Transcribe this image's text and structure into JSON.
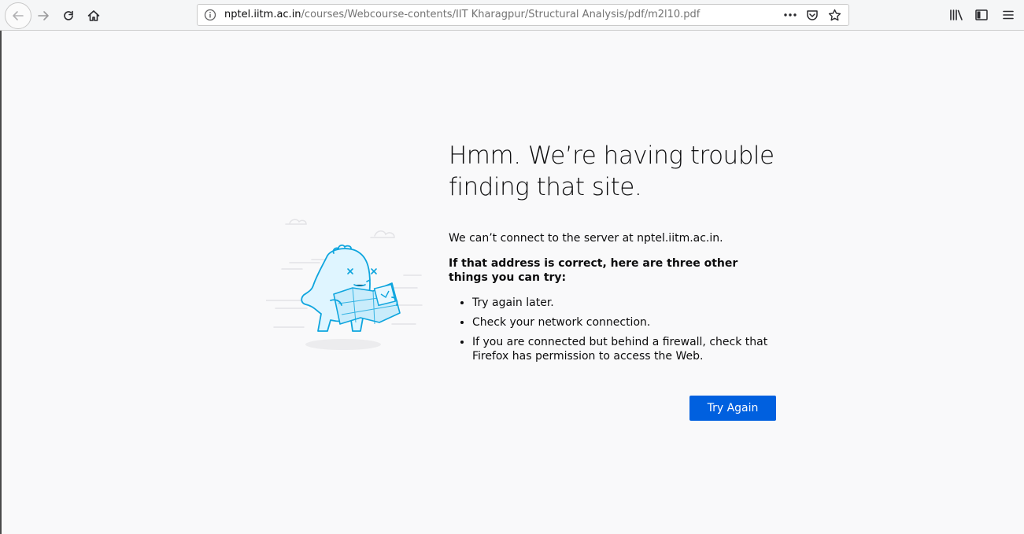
{
  "browser": {
    "url_host": "nptel.iitm.ac.in",
    "url_path": "/courses/Webcourse-contents/IIT Kharagpur/Structural Analysis/pdf/m2l10.pdf",
    "icons": {
      "back": "arrow-left-icon",
      "forward": "arrow-right-icon",
      "reload": "reload-icon",
      "home": "home-icon",
      "info": "info-icon",
      "page_actions": "more-icon",
      "pocket": "pocket-icon",
      "bookmark": "star-icon",
      "library": "library-icon",
      "sidebar": "sidebar-icon",
      "menu": "hamburger-menu-icon"
    }
  },
  "error": {
    "title": "Hmm. We’re having trouble finding that site.",
    "message": "We can’t connect to the server at nptel.iitm.ac.in.",
    "suggestion_heading": "If that address is correct, here are three other things you can try:",
    "tips": [
      "Try again later.",
      "Check your network connection.",
      "If you are connected but behind a firewall, check that Firefox has permission to access the Web."
    ],
    "try_again_label": "Try Again",
    "accent_color": "#0060df"
  }
}
